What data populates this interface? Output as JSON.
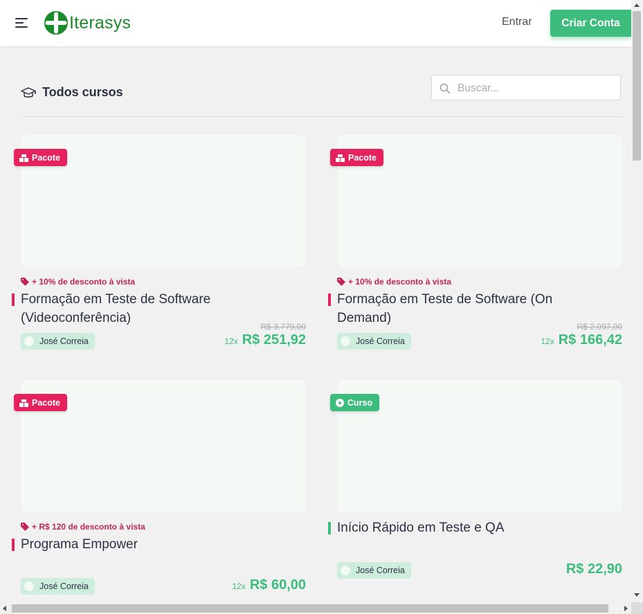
{
  "header": {
    "logo_text": "Iterasys",
    "login_label": "Entrar",
    "signup_label": "Criar Conta"
  },
  "catalog": {
    "title": "Todos cursos",
    "search_placeholder": "Buscar..."
  },
  "colors": {
    "brand_green": "#3dbd7d",
    "package_pink": "#e5225d",
    "logo_green": "#1a8a2a"
  },
  "courses": [
    {
      "badge": "Pacote",
      "badge_icon": "package-icon",
      "discount": "+ 10% de desconto à vista",
      "title": "Formação em Teste de Software (Videoconferência)",
      "author": "José Correia",
      "old_price": "R$ 3.779,00",
      "installments": "12x",
      "price": "R$ 251,92"
    },
    {
      "badge": "Pacote",
      "badge_icon": "package-icon",
      "discount": "+ 10% de desconto à vista",
      "title": "Formação em Teste de Software (On Demand)",
      "author": "José Correia",
      "old_price": "R$ 2.097,00",
      "installments": "12x",
      "price": "R$ 166,42"
    },
    {
      "badge": "Pacote",
      "badge_icon": "package-icon",
      "discount": "+ R$ 120 de desconto à vista",
      "title": "Programa Empower",
      "author": "José Correia",
      "installments": "12x",
      "price": "R$ 60,00"
    },
    {
      "badge": "Curso",
      "badge_icon": "play-icon",
      "title": "Início Rápido em Teste e QA",
      "author": "José Correia",
      "price": "R$ 22,90"
    }
  ]
}
